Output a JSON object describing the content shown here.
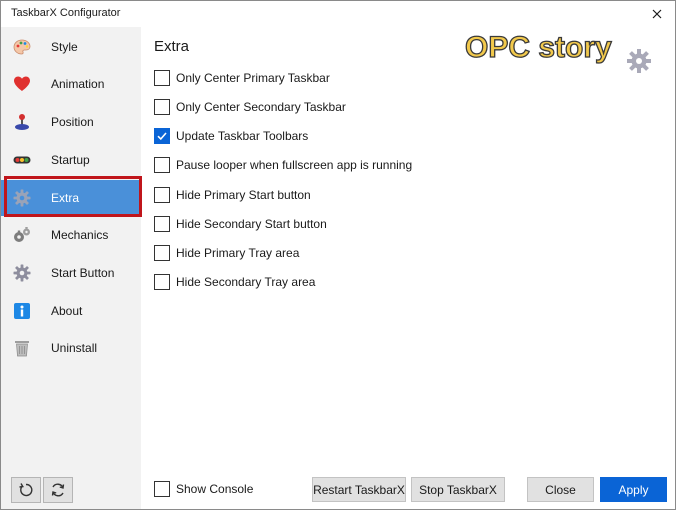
{
  "window": {
    "title": "TaskbarX Configurator"
  },
  "sidebar": {
    "items": [
      {
        "label": "Style",
        "icon": "palette-icon"
      },
      {
        "label": "Animation",
        "icon": "heart-icon"
      },
      {
        "label": "Position",
        "icon": "joystick-icon"
      },
      {
        "label": "Startup",
        "icon": "traffic-light-icon"
      },
      {
        "label": "Extra",
        "icon": "gear-icon",
        "active": true
      },
      {
        "label": "Mechanics",
        "icon": "mechanics-gear-icon"
      },
      {
        "label": "Start Button",
        "icon": "gear-icon"
      },
      {
        "label": "About",
        "icon": "info-icon"
      },
      {
        "label": "Uninstall",
        "icon": "trash-icon"
      }
    ]
  },
  "main": {
    "title": "Extra",
    "watermark": "OPC story",
    "options": [
      {
        "label": "Only Center Primary Taskbar",
        "checked": false
      },
      {
        "label": "Only Center Secondary Taskbar",
        "checked": false
      },
      {
        "label": "Update Taskbar Toolbars",
        "checked": true
      },
      {
        "label": "Pause looper when fullscreen app is running",
        "checked": false
      },
      {
        "label": "Hide Primary Start button",
        "checked": false
      },
      {
        "label": "Hide Secondary Start button",
        "checked": false
      },
      {
        "label": "Hide Primary Tray area",
        "checked": false
      },
      {
        "label": "Hide Secondary Tray area",
        "checked": false
      }
    ]
  },
  "footer": {
    "show_console": "Show Console",
    "restart": "Restart TaskbarX",
    "stop": "Stop TaskbarX",
    "close": "Close",
    "apply": "Apply"
  },
  "colors": {
    "accent": "#0a64d6",
    "active_nav": "#4a90d9",
    "highlight_border": "#c0151b",
    "sidebar_bg": "#f2f2f2",
    "watermark": "#f2c94c"
  }
}
